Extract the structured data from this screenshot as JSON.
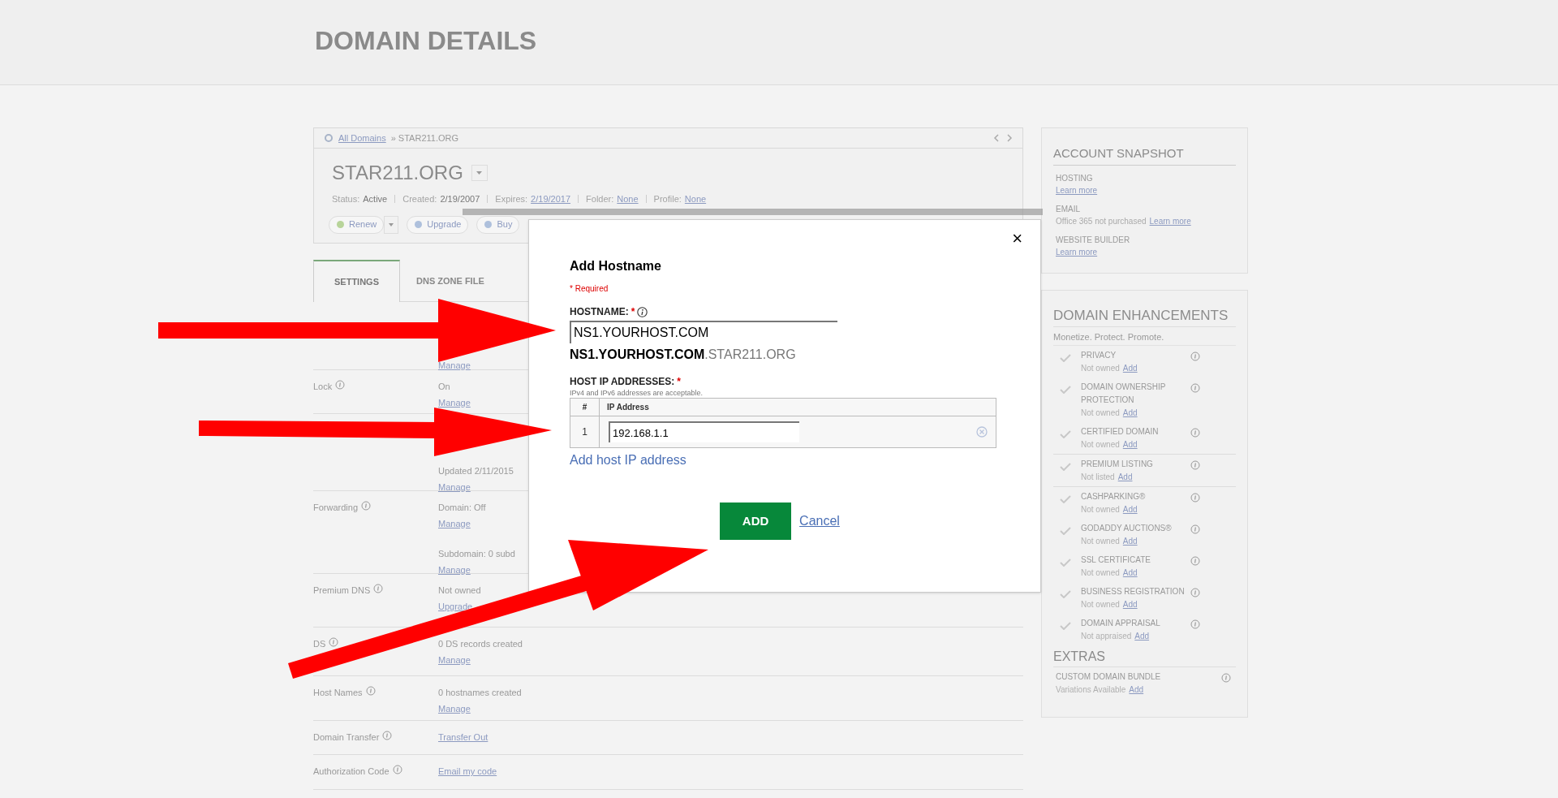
{
  "page_title": "DOMAIN DETAILS",
  "domain_card": {
    "breadcrumb": {
      "link": "All Domains",
      "current": "» STAR211.ORG"
    },
    "domain_name": "STAR211.ORG",
    "status": [
      {
        "label": "Status:",
        "value": "Active",
        "kind": "text"
      },
      {
        "label": "Created:",
        "value": "2/19/2007",
        "kind": "text"
      },
      {
        "label": "Expires:",
        "value": "2/19/2017",
        "kind": "link"
      },
      {
        "label": "Folder:",
        "value": "None",
        "kind": "link"
      },
      {
        "label": "Profile:",
        "value": "None",
        "kind": "link"
      }
    ],
    "actions": [
      "Renew",
      "Upgrade",
      "Buy"
    ]
  },
  "tabs": [
    {
      "label": "SETTINGS",
      "selected": true
    },
    {
      "label": "DNS ZONE FILE",
      "selected": false
    }
  ],
  "settings": [
    {
      "values": [
        {
          "text": "Manage",
          "kind": "link"
        }
      ]
    },
    {
      "label": "Lock",
      "values": [
        {
          "text": "On",
          "kind": "text"
        },
        {
          "text": "Manage",
          "kind": "link"
        }
      ]
    },
    {
      "values": [
        {
          "text": "Updated 2/11/2015",
          "kind": "text"
        },
        {
          "text": "Manage",
          "kind": "link"
        }
      ]
    },
    {
      "label": "Forwarding",
      "values": [
        {
          "text": "Domain: Off",
          "kind": "text"
        },
        {
          "text": "Manage",
          "kind": "link"
        },
        {
          "text": "Subdomain: 0 subd",
          "kind": "text"
        },
        {
          "text": "Manage",
          "kind": "link"
        }
      ]
    },
    {
      "label": "Premium DNS",
      "values": [
        {
          "text": "Not owned",
          "kind": "text"
        },
        {
          "text": "Upgrade",
          "kind": "link"
        }
      ]
    },
    {
      "label": "DS",
      "values": [
        {
          "text": "0 DS records created",
          "kind": "text"
        },
        {
          "text": "Manage",
          "kind": "link"
        }
      ]
    },
    {
      "label": "Host Names",
      "values": [
        {
          "text": "0 hostnames created",
          "kind": "text"
        },
        {
          "text": "Manage",
          "kind": "link"
        }
      ]
    },
    {
      "label": "Domain Transfer",
      "values": [
        {
          "text": "Transfer Out",
          "kind": "link"
        }
      ]
    },
    {
      "label": "Authorization Code",
      "values": [
        {
          "text": "Email my code",
          "kind": "link"
        }
      ]
    }
  ],
  "account_snapshot": {
    "title": "ACCOUNT SNAPSHOT",
    "items": [
      {
        "name": "HOSTING",
        "link": "Learn more"
      },
      {
        "name": "EMAIL",
        "text": "Office 365 not purchased",
        "link": "Learn more"
      },
      {
        "name": "WEBSITE BUILDER",
        "link": "Learn more"
      }
    ]
  },
  "enhancements": {
    "title": "DOMAIN ENHANCEMENTS",
    "tagline": "Monetize. Protect. Promote.",
    "items": [
      {
        "name": "PRIVACY",
        "status": "Not owned",
        "link": "Add"
      },
      {
        "name": "DOMAIN OWNERSHIP PROTECTION",
        "status": "Not owned",
        "link": "Add"
      },
      {
        "name": "CERTIFIED DOMAIN",
        "status": "Not owned",
        "link": "Add"
      },
      {
        "name": "PREMIUM LISTING",
        "status": "Not listed",
        "link": "Add"
      },
      {
        "name": "CASHPARKING®",
        "status": "Not owned",
        "link": "Add"
      },
      {
        "name": "GODADDY AUCTIONS®",
        "status": "Not owned",
        "link": "Add"
      },
      {
        "name": "SSL CERTIFICATE",
        "status": "Not owned",
        "link": "Add"
      },
      {
        "name": "BUSINESS REGISTRATION",
        "status": "Not owned",
        "link": "Add"
      },
      {
        "name": "DOMAIN APPRAISAL",
        "status": "Not appraised",
        "link": "Add"
      }
    ]
  },
  "extras": {
    "title": "EXTRAS",
    "items": [
      {
        "name": "CUSTOM DOMAIN BUNDLE",
        "status": "Variations Available",
        "link": "Add"
      }
    ]
  },
  "modal": {
    "close": "×",
    "title": "Add Hostname",
    "required_note": "* Required",
    "hostname_label": "HOSTNAME:",
    "required_mark": "*",
    "hostname_value": "NS1.YOURHOST.COM",
    "preview_host": "NS1.YOURHOST.COM",
    "preview_domain": ".STAR211.ORG",
    "ip_label": "HOST IP ADDRESSES:",
    "ip_hint": "IPv4 and IPv6 addresses are acceptable.",
    "columns": [
      "#",
      "IP Address"
    ],
    "rows": [
      {
        "index": "1",
        "value": "192.168.1.1"
      }
    ],
    "add_link": "Add host IP address",
    "add_button": "ADD",
    "cancel": "Cancel"
  }
}
